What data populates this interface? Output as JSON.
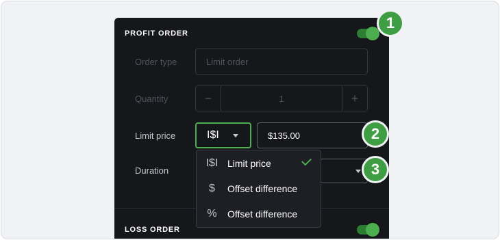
{
  "profit_order": {
    "title": "PROFIT ORDER",
    "toggle_on": true,
    "order_type": {
      "label": "Order type",
      "placeholder": "Limit order"
    },
    "quantity": {
      "label": "Quantity",
      "value": "1",
      "minus": "−",
      "plus": "+"
    },
    "limit_price": {
      "label": "Limit price",
      "unit_glyph": "I$I",
      "value": "$135.00"
    },
    "duration": {
      "label": "Duration"
    }
  },
  "unit_dropdown": {
    "options": [
      {
        "icon": "I$I",
        "label": "Limit price",
        "selected": true
      },
      {
        "icon": "$",
        "label": "Offset difference",
        "selected": false
      },
      {
        "icon": "%",
        "label": "Offset difference",
        "selected": false
      }
    ]
  },
  "loss_order": {
    "title": "LOSS ORDER",
    "toggle_on": true
  },
  "badges": [
    "1",
    "2",
    "3"
  ],
  "colors": {
    "accent": "#4cae4f",
    "panel": "#16171b",
    "badge": "#3f9e44"
  }
}
